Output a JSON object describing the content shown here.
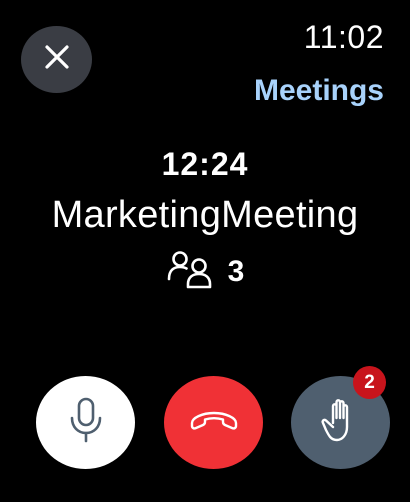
{
  "status_bar": {
    "time": "11:02",
    "app_title": "Meetings"
  },
  "call": {
    "duration": "12:24",
    "meeting_name": "MarketingMeeting",
    "participant_count": "3"
  },
  "controls": {
    "close_icon": "close-icon",
    "mic_icon": "microphone-icon",
    "hangup_icon": "phone-hangup-icon",
    "raise_hand_icon": "raised-hand-icon",
    "raise_hand_badge": "2"
  },
  "colors": {
    "accent_title": "#a8d2fb",
    "hangup": "#f03136",
    "badge": "#c8141c",
    "mic_bg": "#ffffff",
    "raise_hand_bg": "#4f5f6f",
    "close_bg": "#3a3d44"
  }
}
